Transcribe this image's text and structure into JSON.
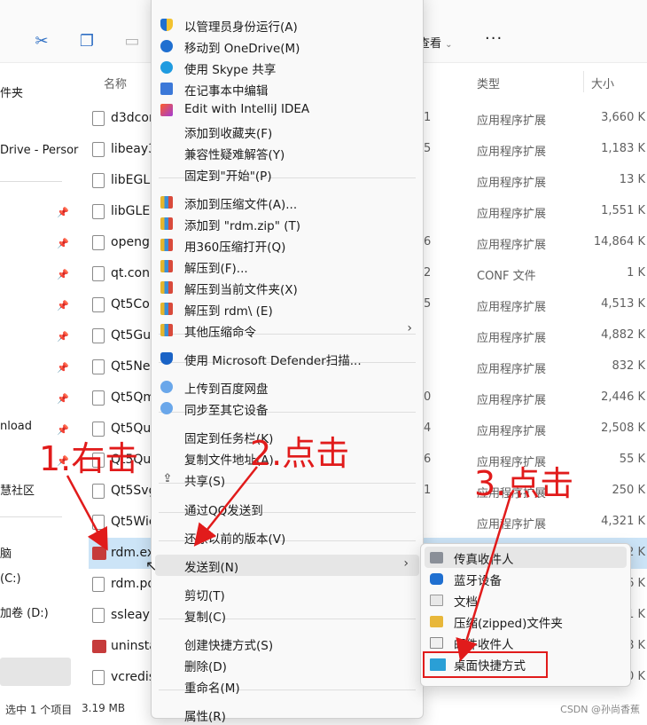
{
  "toolbar": {
    "view_label": "查看",
    "more_label": "···"
  },
  "columns": {
    "name": "名称",
    "type": "类型",
    "size": "大小"
  },
  "nav": {
    "items": [
      {
        "label": "件夹"
      },
      {
        "label": "Drive - Persor"
      },
      {
        "label": "nload"
      },
      {
        "label": "慧社区"
      },
      {
        "label": "脑"
      },
      {
        "label": "(C:)"
      },
      {
        "label": "加卷 (D:)"
      }
    ]
  },
  "files": [
    {
      "name": "d3dcon",
      "date": "1",
      "type": "应用程序扩展",
      "size": "3,660 K"
    },
    {
      "name": "libeay3",
      "date": "5",
      "type": "应用程序扩展",
      "size": "1,183 K"
    },
    {
      "name": "libEGL.",
      "date": "",
      "type": "应用程序扩展",
      "size": "13 K"
    },
    {
      "name": "libGLES",
      "date": "",
      "type": "应用程序扩展",
      "size": "1,551 K"
    },
    {
      "name": "openg",
      "date": "6",
      "type": "应用程序扩展",
      "size": "14,864 K"
    },
    {
      "name": "qt.con",
      "date": "2",
      "type": "CONF 文件",
      "size": "1 K"
    },
    {
      "name": "Qt5Cor",
      "date": "5",
      "type": "应用程序扩展",
      "size": "4,513 K"
    },
    {
      "name": "Qt5Gui",
      "date": "",
      "type": "应用程序扩展",
      "size": "4,882 K"
    },
    {
      "name": "Qt5Ne",
      "date": "",
      "type": "应用程序扩展",
      "size": "832 K"
    },
    {
      "name": "Qt5Qm",
      "date": "0",
      "type": "应用程序扩展",
      "size": "2,446 K"
    },
    {
      "name": "Qt5Qu",
      "date": "4",
      "type": "应用程序扩展",
      "size": "2,508 K"
    },
    {
      "name": "Qt5Qu",
      "date": "6",
      "type": "应用程序扩展",
      "size": "55 K"
    },
    {
      "name": "Qt5Svg",
      "date": "1",
      "type": "应用程序扩展",
      "size": "250 K"
    },
    {
      "name": "Qt5Wic",
      "date": "",
      "type": "应用程序扩展",
      "size": "4,321 K"
    },
    {
      "name": "rdm.ex",
      "date": "",
      "type": "",
      "size": "72 K"
    },
    {
      "name": "rdm.pd",
      "date": "",
      "type": "",
      "size": "16 K"
    },
    {
      "name": "ssleay3",
      "date": "",
      "type": "",
      "size": "91 K"
    },
    {
      "name": "uninsta",
      "date": "",
      "type": "",
      "size": "98 K"
    },
    {
      "name": "vcredis",
      "date": "",
      "type": "",
      "size": "14,120 K"
    }
  ],
  "status": {
    "selection": "选中 1 个项目",
    "size": "3.19 MB"
  },
  "watermark": "CSDN @孙尚香蕉",
  "context_menu": [
    {
      "label": "以管理员身份运行(A)",
      "icon": "shield-icon"
    },
    {
      "label": "移动到 OneDrive(M)",
      "icon": "cloud-icon"
    },
    {
      "label": "使用 Skype 共享",
      "icon": "skype-icon"
    },
    {
      "label": "在记事本中编辑",
      "icon": "notepad-icon"
    },
    {
      "label": "Edit with IntelliJ IDEA",
      "icon": "intellij-icon"
    },
    {
      "label": "添加到收藏夹(F)",
      "icon": ""
    },
    {
      "label": "兼容性疑难解答(Y)",
      "icon": ""
    },
    {
      "label": "固定到\"开始\"(P)",
      "icon": ""
    },
    {
      "label": "添加到压缩文件(A)...",
      "icon": "archive-icon"
    },
    {
      "label": "添加到 \"rdm.zip\" (T)",
      "icon": "archive-icon"
    },
    {
      "label": "用360压缩打开(Q)",
      "icon": "archive-icon"
    },
    {
      "label": "解压到(F)...",
      "icon": "archive-icon"
    },
    {
      "label": "解压到当前文件夹(X)",
      "icon": "archive-icon"
    },
    {
      "label": "解压到 rdm\\ (E)",
      "icon": "archive-icon"
    },
    {
      "label": "其他压缩命令",
      "icon": "archive-icon"
    },
    {
      "label": "使用 Microsoft Defender扫描...",
      "icon": "defender-icon"
    },
    {
      "label": "上传到百度网盘",
      "icon": "baidu-icon"
    },
    {
      "label": "同步至其它设备",
      "icon": "baidu-icon"
    },
    {
      "label": "固定到任务栏(K)",
      "icon": ""
    },
    {
      "label": "复制文件地址(A)",
      "icon": ""
    },
    {
      "label": "共享(S)",
      "icon": "share-icon"
    },
    {
      "label": "通过QQ发送到",
      "icon": ""
    },
    {
      "label": "还原以前的版本(V)",
      "icon": ""
    },
    {
      "label": "发送到(N)",
      "icon": ""
    },
    {
      "label": "剪切(T)",
      "icon": ""
    },
    {
      "label": "复制(C)",
      "icon": ""
    },
    {
      "label": "创建快捷方式(S)",
      "icon": ""
    },
    {
      "label": "删除(D)",
      "icon": ""
    },
    {
      "label": "重命名(M)",
      "icon": ""
    },
    {
      "label": "属性(R)",
      "icon": ""
    }
  ],
  "send_to_menu": [
    {
      "label": "传真收件人",
      "icon": "fax-icon"
    },
    {
      "label": "蓝牙设备",
      "icon": "bluetooth-icon"
    },
    {
      "label": "文档",
      "icon": "document-icon"
    },
    {
      "label": "压缩(zipped)文件夹",
      "icon": "zip-folder-icon"
    },
    {
      "label": "邮件收件人",
      "icon": "mail-icon"
    },
    {
      "label": "桌面快捷方式",
      "icon": "desktop-icon"
    }
  ],
  "annotations": {
    "step1": "1.右击",
    "step2": "2.点击",
    "step3": "3.点击"
  },
  "colors": {
    "annotation": "#e11b1b",
    "selection": "#cce4f7",
    "accent": "#0067c0"
  }
}
